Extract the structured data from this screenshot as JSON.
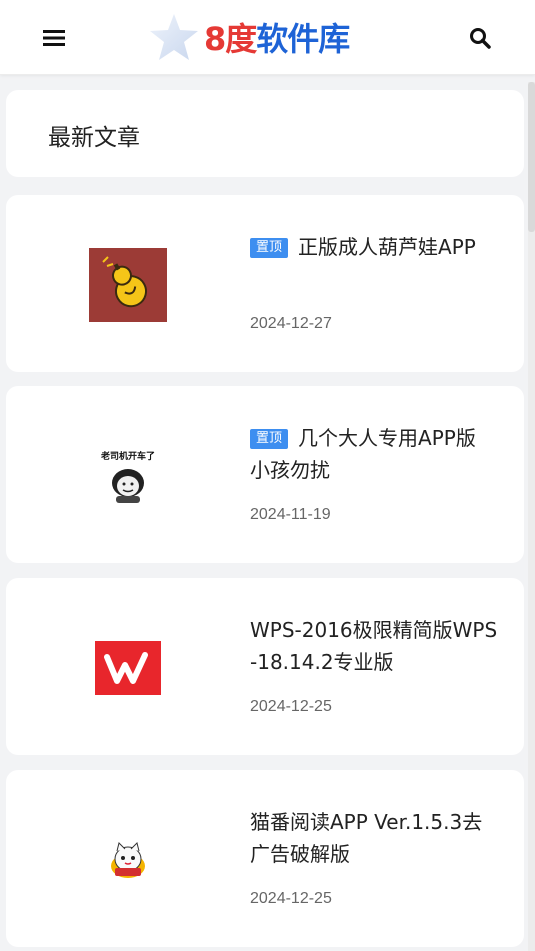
{
  "header": {
    "logo_num": "8",
    "logo_red": "度",
    "logo_blue": "软件库",
    "menu_icon": "hamburger-menu-icon",
    "search_icon": "search-icon",
    "colors": {
      "red": "#e53935",
      "blue": "#1e63d6"
    }
  },
  "section": {
    "title": "最新文章"
  },
  "articles": [
    {
      "badge": "置顶",
      "title": "正版成人葫芦娃APP",
      "date": "2024-12-27",
      "thumb_icon": "gourd-app-icon"
    },
    {
      "badge": "置顶",
      "title": "几个大人专用APP版 小孩勿扰",
      "date": "2024-11-19",
      "thumb_icon": "meme-driver-icon",
      "thumb_caption": "老司机开车了"
    },
    {
      "title": "WPS-2016极限精简版WPS-18.14.2专业版",
      "date": "2024-12-25",
      "thumb_icon": "wps-logo-icon"
    },
    {
      "title": "猫番阅读APP Ver.1.5.3去广告破解版",
      "date": "2024-12-25",
      "thumb_icon": "cat-reader-icon"
    }
  ],
  "accent_color": "#3d8ef0"
}
